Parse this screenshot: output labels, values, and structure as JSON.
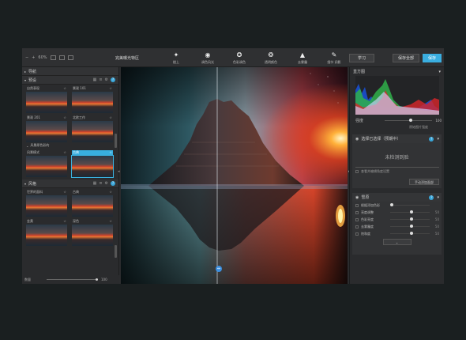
{
  "toolbar": {
    "zoom": "60%",
    "title": "完美曝光特区",
    "tools": [
      {
        "icon": "enhance-icon",
        "glyph": "✦",
        "label": "楼上"
      },
      {
        "icon": "palette-icon",
        "glyph": "◉",
        "label": "调色风光"
      },
      {
        "icon": "tone-icon",
        "glyph": "✪",
        "label": "色彩调色"
      },
      {
        "icon": "light-icon",
        "glyph": "❂",
        "label": "透明颜色"
      },
      {
        "icon": "mountain-icon",
        "glyph": "▲",
        "label": "去雾霾"
      },
      {
        "icon": "detail-icon",
        "glyph": "✎",
        "label": "细节 润影"
      }
    ],
    "learn": "学习",
    "save_all": "保存全部",
    "save": "保存"
  },
  "left_panel": {
    "nav_header": "导航",
    "presets_header": "预设",
    "presets": [
      {
        "label": "自然表现",
        "star": "☆"
      },
      {
        "label": "景观 101",
        "star": "☆"
      },
      {
        "label": "景观 201",
        "star": "☆"
      },
      {
        "label": "北欧工作",
        "star": "☆"
      }
    ],
    "group_label": "风景原色彩的",
    "presets2": [
      {
        "label": "风景模式",
        "star": "☆"
      },
      {
        "label": "古典",
        "star": "☆"
      }
    ],
    "look_header": "风格",
    "looks": [
      {
        "label": "世界的面料",
        "star": "☆"
      },
      {
        "label": "古典",
        "star": "☆"
      },
      {
        "label": "金黄",
        "star": "☆"
      },
      {
        "label": "深色",
        "star": "☆"
      }
    ],
    "amount_label": "数量",
    "amount_value": "100",
    "amount_fraction": 1.0
  },
  "right_panel": {
    "histogram_title": "直方图",
    "intensity_label": "强度",
    "intensity_value": "100",
    "intensity_fraction": 0.55,
    "histogram_hint": "原始图片强度",
    "ai_section": "选择已选择（预期中）",
    "ai_status": "未检测到脸",
    "ai_check": "查看并编辑角度设置",
    "ai_button": "手动添加面部",
    "adjust_section": "雪原",
    "adjust_items": [
      {
        "label": "根据添加色彩",
        "value": "",
        "fraction": 0.0
      },
      {
        "label": "亮度调整",
        "value": "50",
        "fraction": 0.5
      },
      {
        "label": "色彩亮度",
        "value": "50",
        "fraction": 0.5
      },
      {
        "label": "去雾霾度",
        "value": "50",
        "fraction": 0.5
      },
      {
        "label": "饱和度",
        "value": "50",
        "fraction": 0.5
      }
    ]
  }
}
